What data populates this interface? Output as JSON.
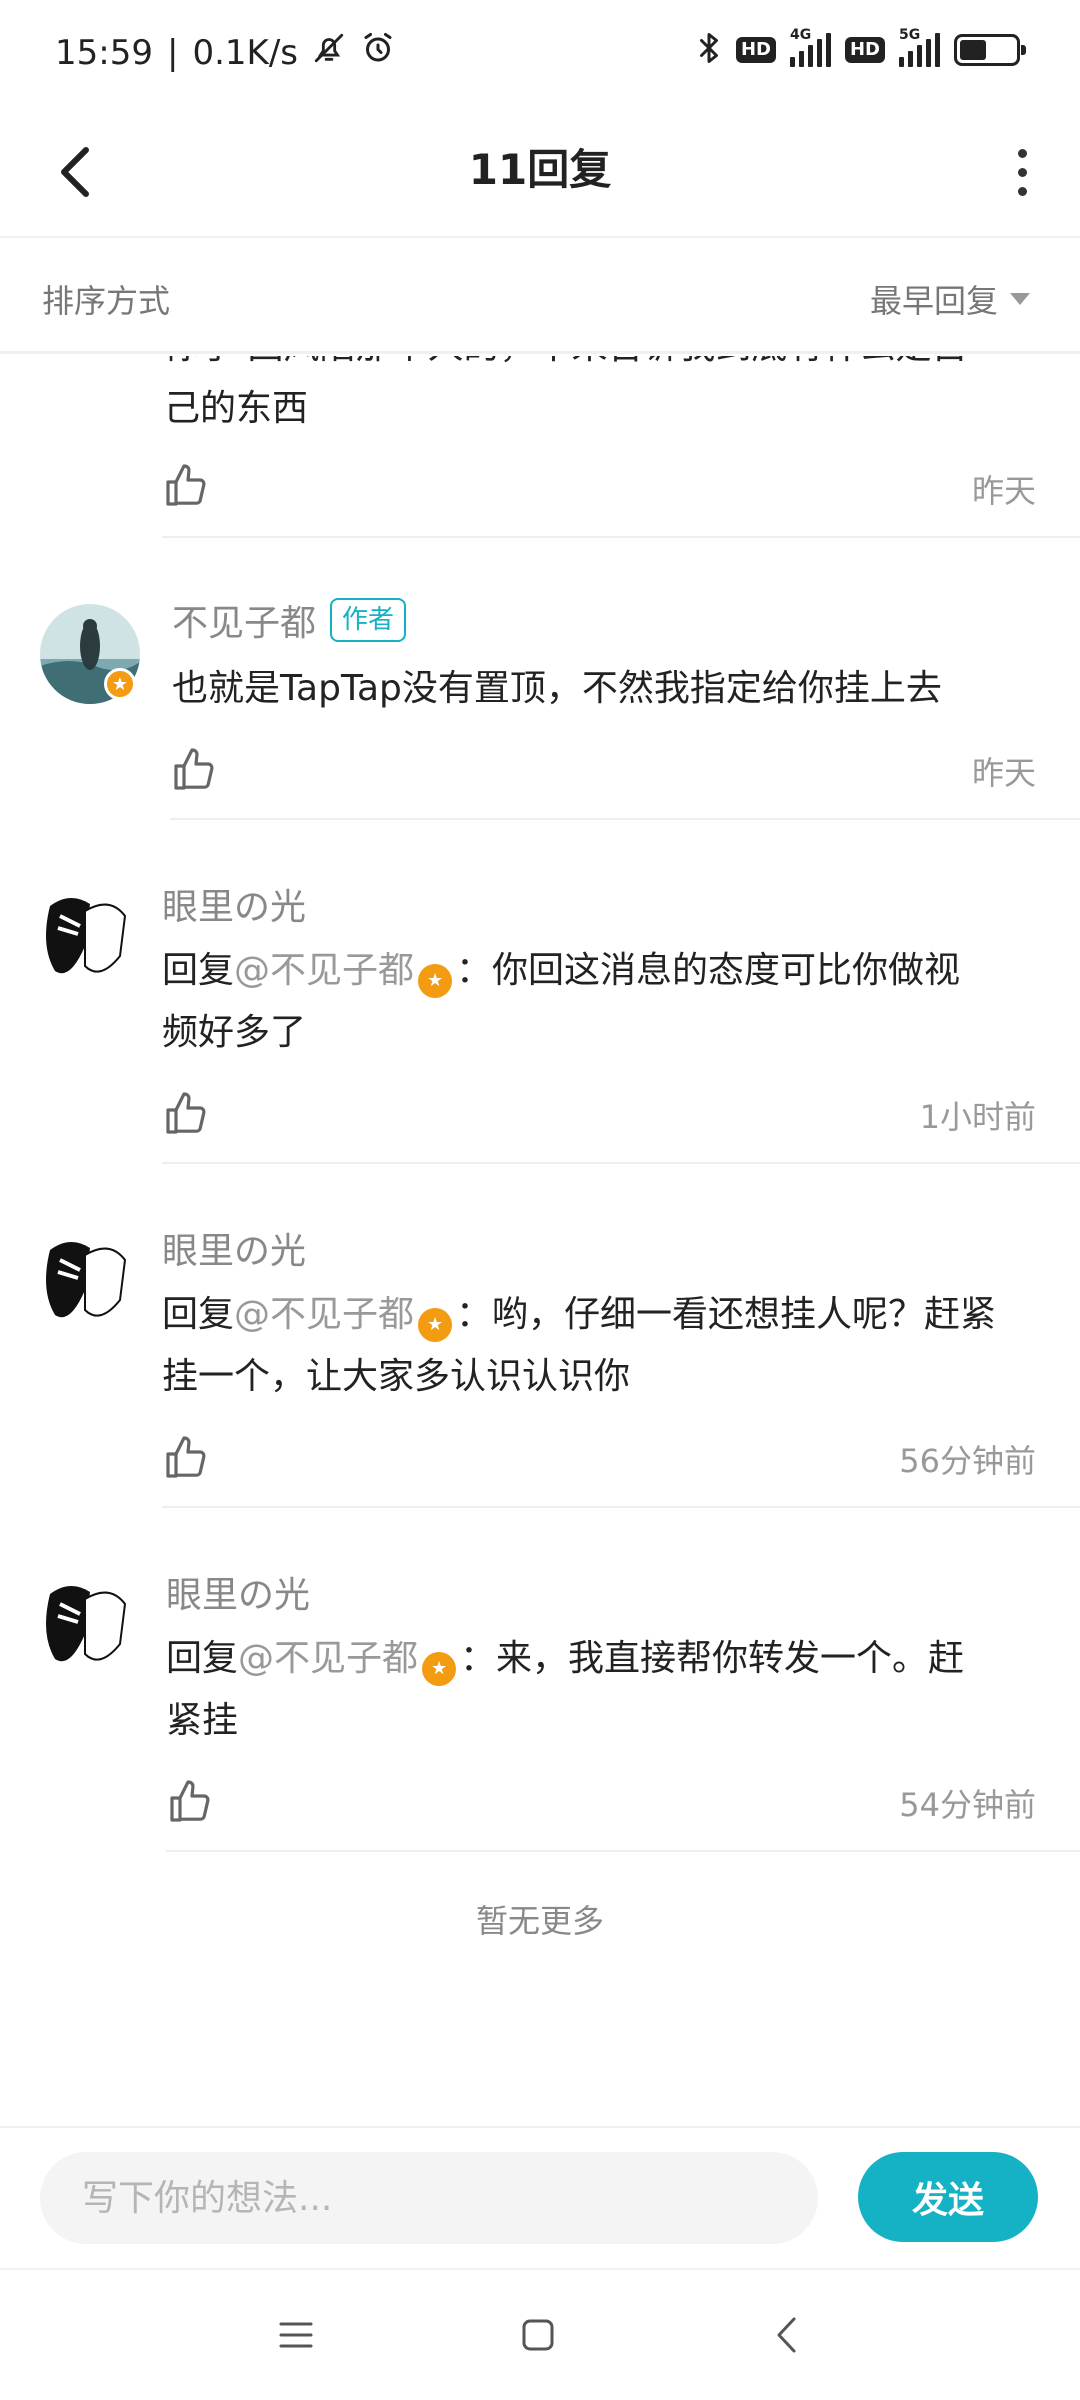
{
  "status_bar": {
    "time": "15:59",
    "speed": "0.1K/s",
    "hd1": "HD",
    "net1": "4G",
    "hd2": "HD",
    "net2": "5G"
  },
  "header": {
    "title": "11回复"
  },
  "sort": {
    "label": "排序方式",
    "selected": "最早回复"
  },
  "partial_reply": {
    "text_lines": [
      "你了·回风陷那个人的，不来告诉我到底有什么是自",
      "己的东西"
    ],
    "time": "昨天"
  },
  "replies": [
    {
      "name": "不见子都",
      "tag": "作者",
      "text": "也就是TapTap没有置顶，不然我指定给你挂上去",
      "time": "昨天"
    },
    {
      "name": "眼里の光",
      "prefix": "回复",
      "mention": "@不见子都",
      "text_line1": "：你回这消息的态度可比你做视",
      "text_line2": "频好多了",
      "time": "1小时前"
    },
    {
      "name": "眼里の光",
      "prefix": "回复",
      "mention": "@不见子都",
      "text_line1": "：哟，仔细一看还想挂人呢？赶紧",
      "text_line2": "挂一个，让大家多认识认识你",
      "time": "56分钟前"
    },
    {
      "name": "眼里の光",
      "prefix": "回复",
      "mention": "@不见子都",
      "text_line1": "：来，我直接帮你转发一个。赶",
      "text_line2": "紧挂",
      "time": "54分钟前"
    }
  ],
  "footer_note": "暂无更多",
  "composer": {
    "placeholder": "写下你的想法...",
    "send_label": "发送"
  },
  "colors": {
    "accent": "#15b1c4",
    "badge": "#f39c12"
  }
}
